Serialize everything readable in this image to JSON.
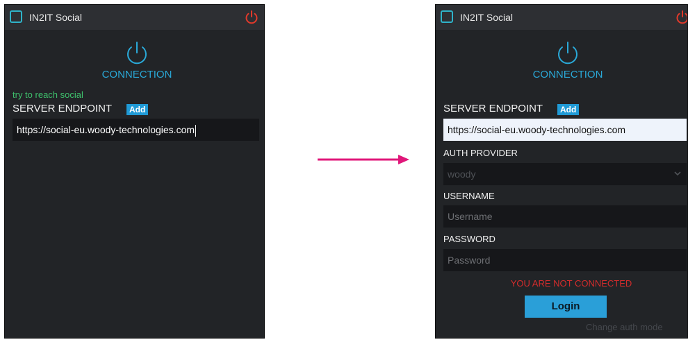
{
  "app": {
    "title": "IN2IT Social"
  },
  "before": {
    "connection_label": "CONNECTION",
    "status": "try to reach social",
    "endpoint_label": "SERVER ENDPOINT",
    "add_label": "Add",
    "endpoint_value": "https://social-eu.woody-technologies.com"
  },
  "after": {
    "connection_label": "CONNECTION",
    "endpoint_label": "SERVER ENDPOINT",
    "add_label": "Add",
    "endpoint_value": "https://social-eu.woody-technologies.com",
    "auth_provider_label": "AUTH PROVIDER",
    "auth_provider_value": "woody",
    "username_label": "USERNAME",
    "username_placeholder": "Username",
    "password_label": "PASSWORD",
    "password_placeholder": "Password",
    "status": "YOU ARE NOT CONNECTED",
    "login_label": "Login",
    "change_auth_label": "Change auth mode"
  },
  "colors": {
    "accent": "#2aa9d8",
    "power_red": "#e0392b",
    "status_green": "#3ec06c",
    "error_red": "#d62c2c",
    "arrow": "#e0177a"
  },
  "icons": {
    "logo": "square-logo-icon",
    "power": "power-icon",
    "chevron": "chevron-down-icon",
    "arrow": "arrow-right-icon"
  }
}
